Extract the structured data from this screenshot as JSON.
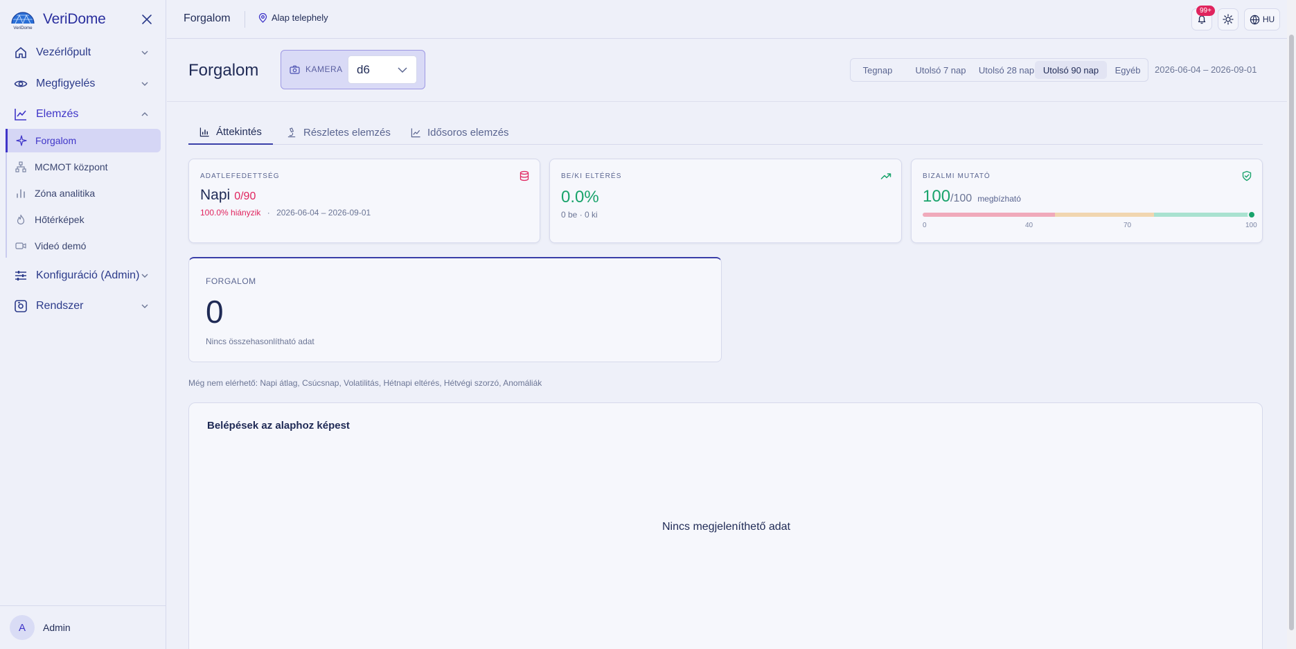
{
  "brand": {
    "name": "VeriDome",
    "logo_text": "VeriDome"
  },
  "sidebar": {
    "groups": [
      {
        "label": "Vezérlőpult",
        "icon": "home-icon"
      },
      {
        "label": "Megfigyelés",
        "icon": "eye-icon"
      },
      {
        "label": "Elemzés",
        "icon": "analytics-icon"
      },
      {
        "label": "Konfiguráció (Admin)",
        "icon": "sliders-icon"
      },
      {
        "label": "Rendszer",
        "icon": "system-icon"
      }
    ],
    "sub_items": [
      {
        "label": "Forgalom",
        "icon": "sparkle-icon",
        "active": true
      },
      {
        "label": "MCMOT központ",
        "icon": "network-icon"
      },
      {
        "label": "Zóna analitika",
        "icon": "bar-chart-icon"
      },
      {
        "label": "Hőtérképek",
        "icon": "flame-icon"
      },
      {
        "label": "Videó demó",
        "icon": "video-icon"
      }
    ]
  },
  "user": {
    "initial": "A",
    "name": "Admin"
  },
  "topbar": {
    "title": "Forgalom",
    "location": "Alap telephely",
    "notifications_badge": "99+",
    "language": "HU"
  },
  "header": {
    "title": "Forgalom",
    "camera_label": "KAMERA",
    "camera_value": "d6",
    "ranges": [
      "Tegnap",
      "Utolsó 7 nap",
      "Utolsó 28 nap",
      "Utolsó 90 nap",
      "Egyéb"
    ],
    "active_range": "Utolsó 90 nap",
    "date_range": "2026-06-04 – 2026-09-01"
  },
  "tabs": [
    {
      "label": "Áttekintés",
      "icon": "bar-chart-icon",
      "active": true
    },
    {
      "label": "Részletes elemzés",
      "icon": "microscope-icon"
    },
    {
      "label": "Idősoros elemzés",
      "icon": "line-chart-icon"
    }
  ],
  "cards": {
    "coverage": {
      "label": "ADATLEFEDETTSÉG",
      "value": "Napi",
      "ratio": "0/90",
      "missing": "100.0% hiányzik",
      "separator": "·",
      "dates": "2026-06-04 – 2026-09-01"
    },
    "inout": {
      "label": "BE/KI ELTÉRÉS",
      "value": "0.0%",
      "sub": "0 be · 0 ki"
    },
    "trust": {
      "label": "BIZALMI MUTATÓ",
      "value": "100",
      "of": "/100",
      "tag": "megbízható",
      "score": 100,
      "ticks": [
        "0",
        "40",
        "70",
        "100"
      ]
    }
  },
  "traffic": {
    "label": "FORGALOM",
    "value": "0",
    "sub": "Nincs összehasonlítható adat"
  },
  "unavailable_note": "Még nem elérhető: Napi átlag, Csúcsnap, Volatilitás, Hétnapi eltérés, Hétvégi szorzó, Anomáliák",
  "chart": {
    "title": "Belépések az alaphoz képest",
    "empty": "Nincs megjeleníthető adat"
  },
  "colors": {
    "accent": "#3f35c8",
    "success": "#19a36b",
    "danger": "#e0245e",
    "gauge_low": "#f0aabb",
    "gauge_mid": "#f1d6b0",
    "gauge_high": "#a9e2d0"
  }
}
